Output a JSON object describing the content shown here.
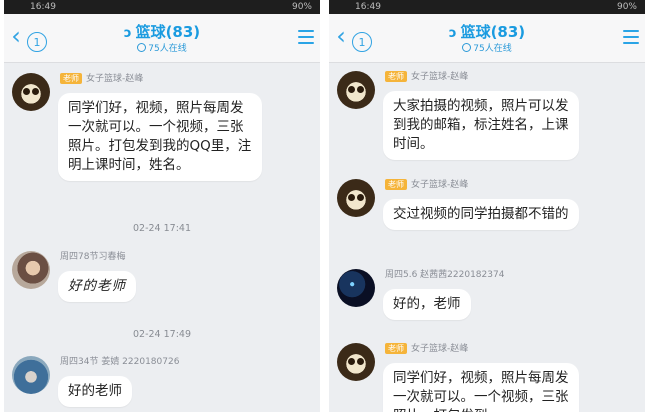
{
  "statusbar": {
    "time": "16:49",
    "battery": "90%"
  },
  "header": {
    "back_icon": "back-chevron-icon",
    "unread": "1",
    "title": "篮球(83)",
    "online": "75人在线",
    "menu_icon": "menu-icon"
  },
  "left": {
    "messages": [
      {
        "role": "老师",
        "sender": "女子篮球-赵峰",
        "text": "同学们好，视频，照片每周发一次就可以。一个视频，三张照片。打包发到我的QQ里，注明上课时间，姓名。"
      },
      {
        "time": "02-24 17:41"
      },
      {
        "sender": "周四78节习春梅",
        "text": "好的老师"
      },
      {
        "time": "02-24 17:49"
      },
      {
        "sender": "周四34节  姜婧 2220180726",
        "text": "好的老师"
      }
    ]
  },
  "right": {
    "messages": [
      {
        "role": "老师",
        "sender": "女子篮球-赵峰",
        "text": "大家拍摄的视频，照片可以发到我的邮箱，标注姓名，上课时间。"
      },
      {
        "role": "老师",
        "sender": "女子篮球-赵峰",
        "text": "交过视频的同学拍摄都不错的"
      },
      {
        "sender": "周四5.6 赵茜茜2220182374",
        "text": "好的，老师"
      },
      {
        "role": "老师",
        "sender": "女子篮球-赵峰",
        "text": "同学们好，视频，照片每周发一次就可以。一个视频，三张照片，打包发到"
      }
    ]
  }
}
